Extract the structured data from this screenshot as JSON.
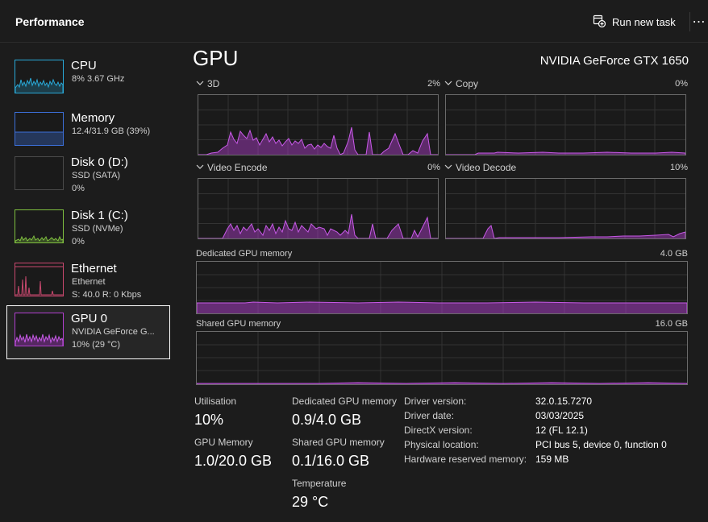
{
  "header": {
    "title": "Performance",
    "run_task_label": "Run new task",
    "more_label": "⋯"
  },
  "sidebar": {
    "items": [
      {
        "name": "CPU",
        "line1": "8%  3.67 GHz",
        "line2": "",
        "color": "#29a9d8"
      },
      {
        "name": "Memory",
        "line1": "12.4/31.9 GB (39%)",
        "line2": "",
        "color": "#3c6fd8"
      },
      {
        "name": "Disk 0 (D:)",
        "line1": "SSD (SATA)",
        "line2": "0%",
        "color": "#7fbf3f"
      },
      {
        "name": "Disk 1 (C:)",
        "line1": "SSD (NVMe)",
        "line2": "0%",
        "color": "#7fbf3f"
      },
      {
        "name": "Ethernet",
        "line1": "Ethernet",
        "line2": "S: 40.0  R: 0 Kbps",
        "color": "#c8486e"
      },
      {
        "name": "GPU 0",
        "line1": "NVIDIA GeForce G...",
        "line2": "10%  (29 °C)",
        "color": "#b13fcf"
      }
    ]
  },
  "main": {
    "title": "GPU",
    "model": "NVIDIA GeForce GTX 1650",
    "engines": [
      {
        "label": "3D",
        "percent": "2%"
      },
      {
        "label": "Copy",
        "percent": "0%"
      },
      {
        "label": "Video Encode",
        "percent": "0%"
      },
      {
        "label": "Video Decode",
        "percent": "10%"
      }
    ],
    "dedicated": {
      "label": "Dedicated GPU memory",
      "max": "4.0 GB"
    },
    "shared": {
      "label": "Shared GPU memory",
      "max": "16.0 GB"
    },
    "graph_color": "#b13fcf"
  },
  "stats": {
    "utilisation_label": "Utilisation",
    "utilisation_value": "10%",
    "gpu_memory_label": "GPU Memory",
    "gpu_memory_value": "1.0/20.0 GB",
    "dedicated_label": "Dedicated GPU memory",
    "dedicated_value": "0.9/4.0 GB",
    "shared_label": "Shared GPU memory",
    "shared_value": "0.1/16.0 GB",
    "temperature_label": "Temperature",
    "temperature_value": "29 °C",
    "details": [
      {
        "key": "Driver version:",
        "value": "32.0.15.7270"
      },
      {
        "key": "Driver date:",
        "value": "03/03/2025"
      },
      {
        "key": "DirectX version:",
        "value": "12 (FL 12.1)"
      },
      {
        "key": "Physical location:",
        "value": "PCI bus 5, device 0, function 0"
      },
      {
        "key": "Hardware reserved memory:",
        "value": "159 MB"
      }
    ]
  }
}
